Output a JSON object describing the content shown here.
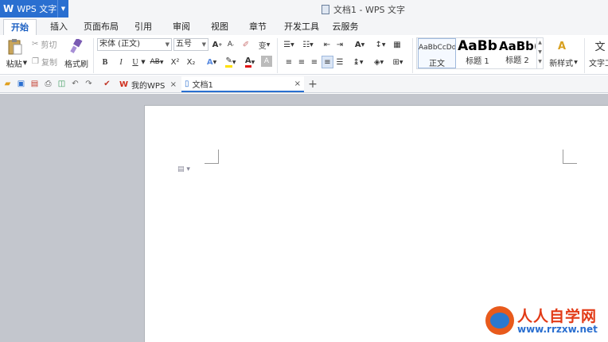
{
  "app": {
    "menu_label": "WPS 文字",
    "logo": "W",
    "title": "文档1 - WPS 文字"
  },
  "menu_tabs": [
    "开始",
    "插入",
    "页面布局",
    "引用",
    "审阅",
    "视图",
    "章节",
    "开发工具",
    "云服务"
  ],
  "ribbon": {
    "paste": "粘贴",
    "cut": "剪切",
    "copy": "复制",
    "format_painter": "格式刷",
    "font_name": "宋体 (正文)",
    "font_size": "五号",
    "bold": "B",
    "italic": "I",
    "underline": "U",
    "superscript": "X²",
    "subscript": "X₂",
    "font_color_label": "A",
    "new_style": "新样式",
    "text_tool": "文字工"
  },
  "styles": [
    {
      "preview": "AaBbCcDd",
      "label": "正文"
    },
    {
      "preview": "AaBb",
      "label": "标题 1"
    },
    {
      "preview": "AaBb(",
      "label": "标题 2"
    }
  ],
  "doc_tabs": [
    {
      "label": "我的WPS",
      "close": "×"
    },
    {
      "label": "文档1",
      "close": "×"
    }
  ],
  "new_tab": "+",
  "watermark": {
    "brand": "人人自学网",
    "url": "www.rrzxw.net"
  },
  "colors": {
    "accent": "#2a6fd0",
    "workspace": "#c3c6cd"
  }
}
